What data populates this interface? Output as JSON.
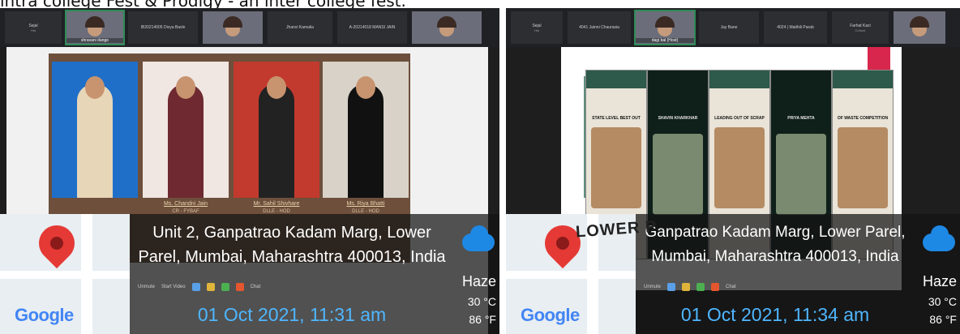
{
  "caption": "intra college Fest & Prodigy - an inter college fest.",
  "left_shot": {
    "participants": [
      {
        "name": "Sejal",
        "sub": "Hst",
        "video": false
      },
      {
        "name": "shravani dange",
        "sub": "",
        "video": true
      },
      {
        "name": "IB20214005 Divya Bavle",
        "sub": "",
        "video": false
      },
      {
        "name": "",
        "sub": "",
        "video": true
      },
      {
        "name": "Jhanvi Kamalia",
        "sub": "",
        "video": false
      },
      {
        "name": "A-20214018 MANSI JAIN",
        "sub": "",
        "video": false
      },
      {
        "name": "",
        "sub": "",
        "video": true
      }
    ],
    "slide": {
      "people": [
        {
          "name": "",
          "role": ""
        },
        {
          "name": "Ms. Chandni Jain",
          "role": "CR - FYBAF"
        },
        {
          "name": "Mr. Sahil Shivhare",
          "role": "DLLE - HOD"
        },
        {
          "name": "Ms. Riya Bhatti",
          "role": "DLLE - HOD"
        }
      ]
    },
    "meet_controls": {
      "unmute": "Unmute",
      "start_video": "Start Video",
      "chat": "Chat"
    },
    "geotag": {
      "address": "Unit 2, Ganpatrao Kadam Marg, Lower Parel, Mumbai, Maharashtra 400013, India",
      "datetime": "01 Oct 2021, 11:31 am",
      "weather": {
        "condition": "Haze",
        "celsius": "30 °C",
        "fahrenheit": "86 °F"
      },
      "map_logo": "Google",
      "help": "?"
    }
  },
  "right_shot": {
    "participants": [
      {
        "name": "Sejal",
        "sub": "Hst",
        "video": false
      },
      {
        "name": "4041 Jainni Chaurasia",
        "sub": "",
        "video": false
      },
      {
        "name": "dagi bal (Host)",
        "sub": "",
        "video": true
      },
      {
        "name": "Jay Bane",
        "sub": "",
        "video": false
      },
      {
        "name": "4024 | Maithili Parab",
        "sub": "",
        "video": false
      },
      {
        "name": "Farhat Kazi",
        "sub": "Cohost",
        "video": false
      },
      {
        "name": "",
        "sub": "",
        "video": true
      }
    ],
    "slide": {
      "posts": [
        {
          "title": "STATE LEVEL BEST OUT",
          "dark": false
        },
        {
          "title": "SHAVIN KHARKHAR",
          "dark": true
        },
        {
          "title": "LEADING OUT OF SCRAP",
          "dark": false
        },
        {
          "title": "PRIYA MEHTA",
          "dark": true
        },
        {
          "title": "OF WASTE COMPETITION",
          "dark": false
        }
      ],
      "lower_text": "LOWER P"
    },
    "meet_controls": {
      "unmute": "Unmute",
      "chat": "Chat"
    },
    "geotag": {
      "address": "Ganpatrao Kadam Marg, Lower Parel, Mumbai, Maharashtra 400013, India",
      "datetime": "01 Oct 2021, 11:34 am",
      "weather": {
        "condition": "Haze",
        "celsius": "30 °C",
        "fahrenheit": "86 °F"
      },
      "map_logo": "Google"
    }
  },
  "colors": {
    "date_blue": "#4fb6ff",
    "pin_red": "#e53935",
    "weather_blue": "#1e88e5",
    "meet_bg": "#202124"
  }
}
